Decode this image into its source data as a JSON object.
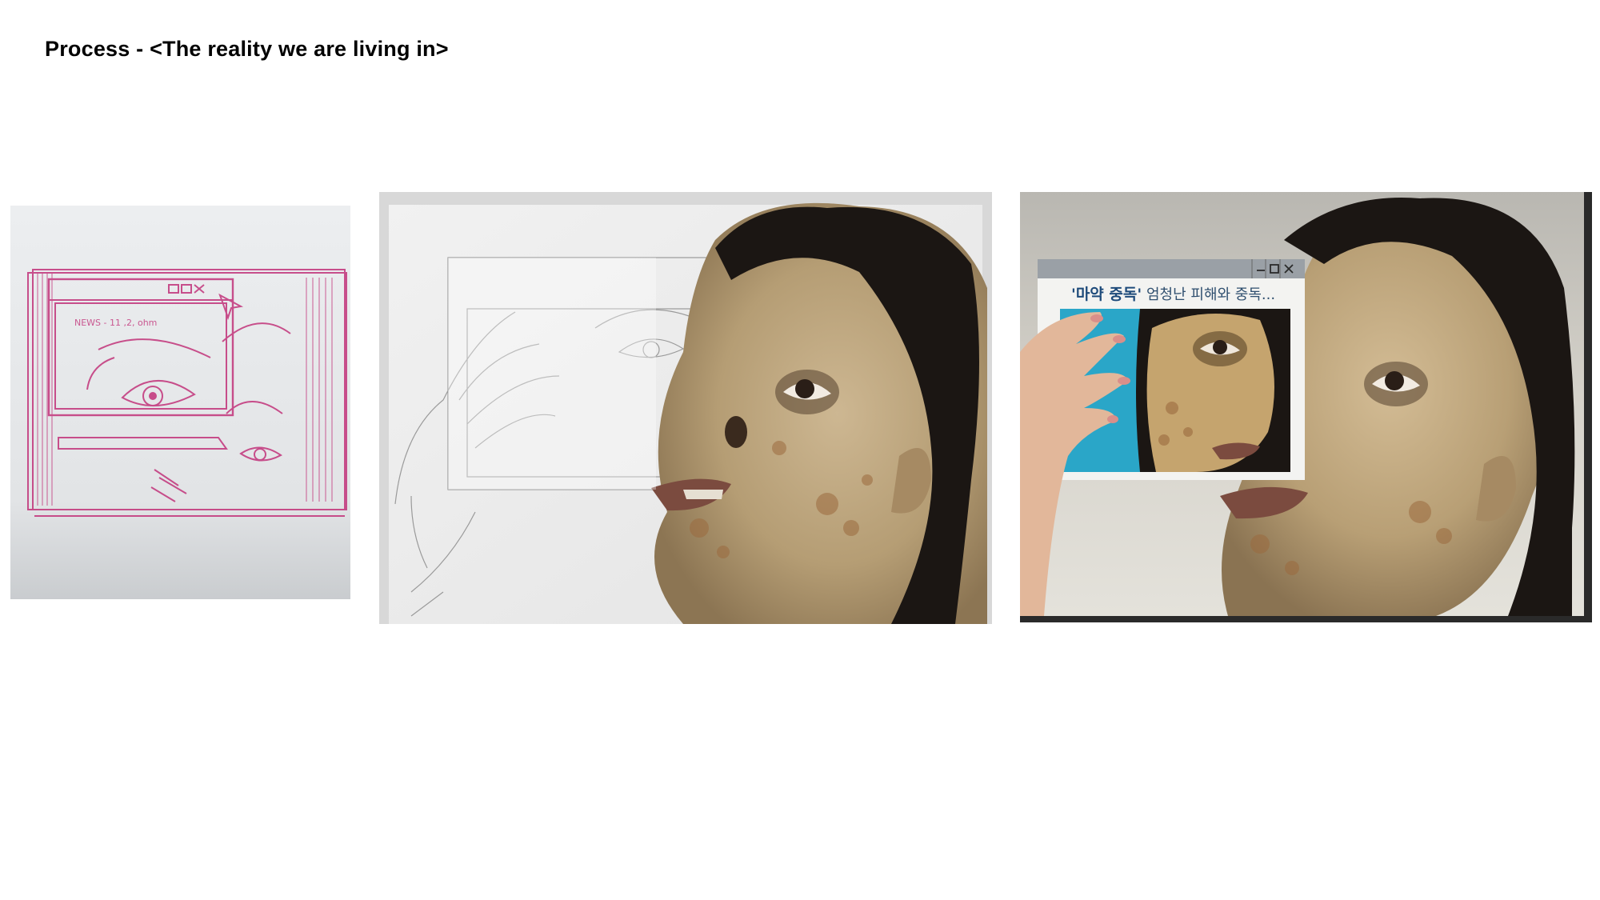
{
  "slide": {
    "title": "Process - <The reality we are living in>"
  },
  "photos": [
    {
      "name": "pink-pencil-thumbnail-sketch",
      "sketch_note": "NEWS - 11 ,2, ohm"
    },
    {
      "name": "pencil-underdrawing-and-painted-face"
    },
    {
      "name": "finished-painting-with-window",
      "window_headline_bold": "'마약 중독'",
      "window_headline_rest": "엄청난 피해와 중독..."
    }
  ],
  "colors": {
    "sketch_pink": "#c2337a",
    "skin": "#c7b08a",
    "hair": "#1b1613",
    "window_bar": "#9aa0a6",
    "window_bg_blue": "#2aa6c8"
  }
}
